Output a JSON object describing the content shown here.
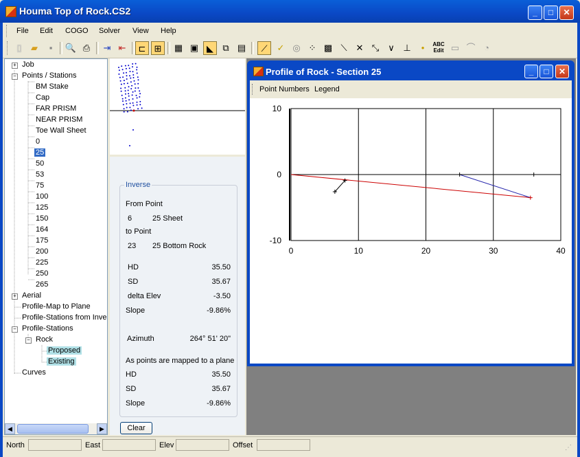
{
  "window": {
    "title": "Houma Top of Rock.CS2"
  },
  "menu": [
    "File",
    "Edit",
    "COGO",
    "Solver",
    "View",
    "Help"
  ],
  "toolbar_icons": [
    "new-file-icon",
    "open-folder-icon",
    "save-icon",
    "print-preview-icon",
    "print-icon",
    "import-icon",
    "export-icon",
    "tree-view-icon",
    "zoom-extents-icon",
    "grid-icon",
    "window-icon",
    "profile-icon",
    "copy-window-icon",
    "layout-icon",
    "measure-icon",
    "check-icon",
    "target-icon",
    "points-icon",
    "grid-points-icon",
    "line-icon",
    "intersect-icon",
    "distance-icon",
    "angle-icon",
    "perpendicular-icon",
    "point-icon",
    "abc-edit-icon",
    "shape-icon",
    "arc-icon",
    "circle-icon"
  ],
  "abc_edit": {
    "top": "ABC",
    "bottom": "Edit"
  },
  "tree": {
    "job": "Job",
    "points_stations": "Points / Stations",
    "points": [
      "BM Stake",
      "Cap",
      "FAR PRISM",
      "NEAR PRISM",
      "Toe Wall Sheet",
      "0",
      "25",
      "50",
      "53",
      "75",
      "100",
      "125",
      "150",
      "164",
      "175",
      "200",
      "225",
      "250",
      "265"
    ],
    "selected": "25",
    "aerial": "Aerial",
    "profile_map": "Profile-Map to Plane",
    "profile_stations_inverse": "Profile-Stations from Invers",
    "profile_stations": "Profile-Stations",
    "rock": "Rock",
    "proposed": "Proposed",
    "existing": "Existing",
    "curves": "Curves"
  },
  "inverse": {
    "group_title": "Inverse",
    "from_point_label": "From Point",
    "from_id": "6",
    "from_name": "25 Sheet",
    "to_point_label": "to Point",
    "to_id": "23",
    "to_name": "25 Bottom Rock",
    "hd_label": "HD",
    "hd": "35.50",
    "sd_label": "SD",
    "sd": "35.67",
    "delta_label": "delta Elev",
    "delta": "-3.50",
    "slope_label": "Slope",
    "slope": "-9.86%",
    "azimuth_label": "Azimuth",
    "azimuth": "264° 51' 20\"",
    "mapped_label": "As points are mapped to a plane",
    "hd2_label": "HD",
    "hd2": "35.50",
    "sd2_label": "SD",
    "sd2": "35.67",
    "slope2_label": "Slope",
    "slope2": "-9.86%",
    "clear": "Clear"
  },
  "profile_window": {
    "title": "Profile of Rock - Section 25",
    "btn_point_numbers": "Point Numbers",
    "btn_legend": "Legend"
  },
  "chart_data": {
    "type": "line",
    "xlim": [
      0,
      40
    ],
    "ylim": [
      -10,
      10
    ],
    "x_ticks": [
      "0",
      "10",
      "20",
      "30",
      "40"
    ],
    "y_ticks": [
      "10",
      "0",
      "-10"
    ],
    "grid": true,
    "series": [
      {
        "color": "#000000",
        "x": [
          0,
          36
        ],
        "y": [
          0,
          0
        ]
      },
      {
        "color": "#cc0000",
        "x": [
          0,
          35.5
        ],
        "y": [
          0,
          -3.5
        ]
      },
      {
        "color": "#2222aa",
        "x": [
          25,
          35.5
        ],
        "y": [
          0,
          -3.5
        ]
      },
      {
        "color": "#000000",
        "x": [
          6.5,
          8
        ],
        "y": [
          -2.6,
          -0.9
        ]
      }
    ],
    "markers": [
      {
        "x": 8,
        "y": -0.9,
        "color": "#000000"
      },
      {
        "x": 6.5,
        "y": -2.6,
        "color": "#000000"
      },
      {
        "x": 25,
        "y": 0,
        "color": "#000000"
      },
      {
        "x": 35.5,
        "y": -3.5,
        "color": "#cc0000"
      },
      {
        "x": 36,
        "y": 0,
        "color": "#000000"
      }
    ]
  },
  "status": {
    "north": "North",
    "east": "East",
    "elev": "Elev",
    "offset": "Offset"
  }
}
